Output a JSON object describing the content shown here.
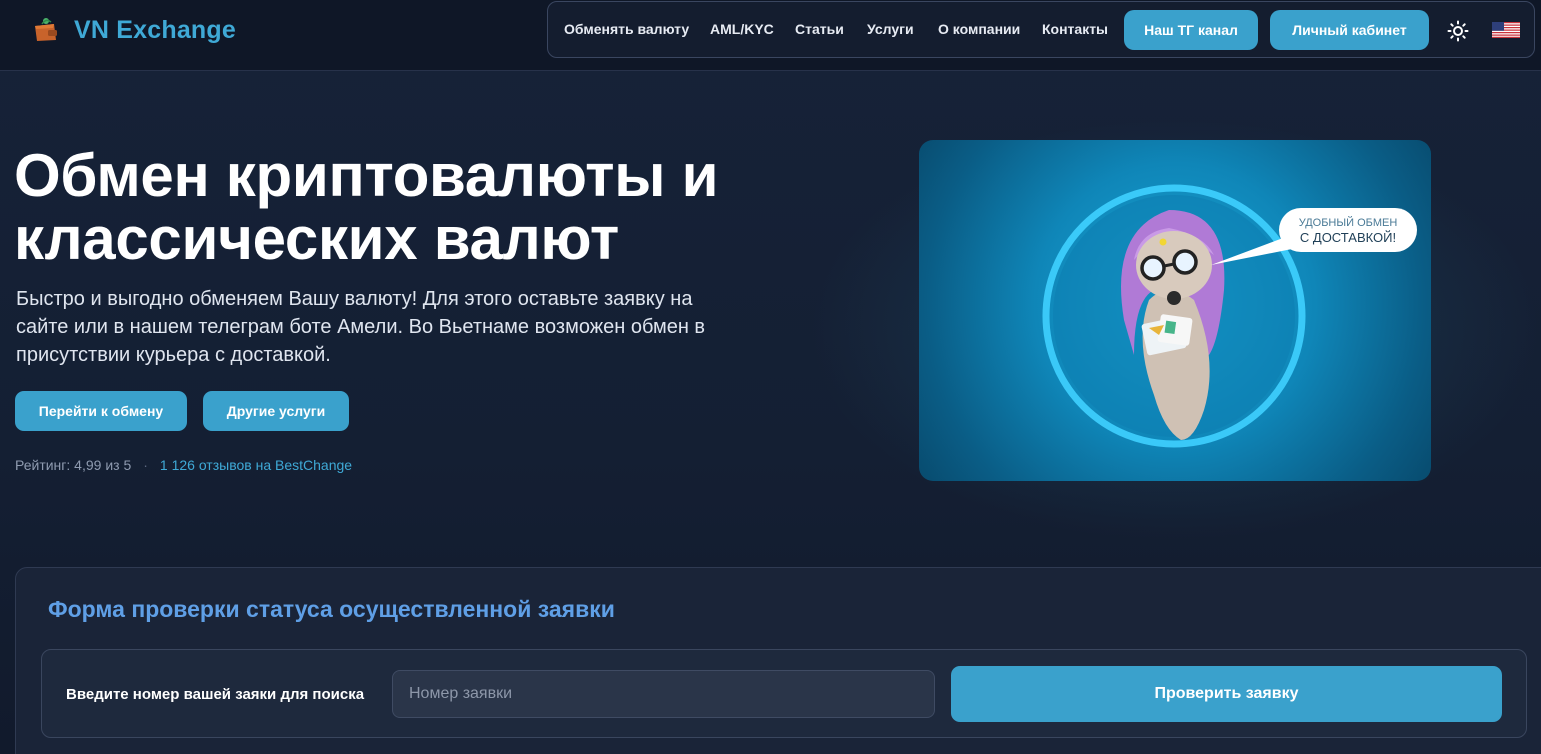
{
  "header": {
    "brand": "VN Exchange",
    "nav": [
      {
        "label": "Обменять валюту"
      },
      {
        "label": "AML/KYC"
      },
      {
        "label": "Статьи"
      },
      {
        "label": "Услуги"
      },
      {
        "label": "О компании"
      },
      {
        "label": "Контакты"
      }
    ],
    "tg_button": "Наш ТГ канал",
    "cabinet_button": "Личный кабинет",
    "theme_icon": "sun-icon",
    "language_icon": "us-flag-icon"
  },
  "hero": {
    "title": "Обмен криптовалюты и классических валют",
    "subtitle": "Быстро и выгодно обменяем Вашу валюту! Для этого оставьте заявку на сайте или в нашем телеграм боте Амели. Во Вьетнаме возможен обмен в присутствии курьера с доставкой.",
    "primary_button": "Перейти к обмену",
    "secondary_button": "Другие услуги",
    "rating": "Рейтинг: 4,99 из 5",
    "separator": "·",
    "reviews": "1 126 отзывов на BestChange",
    "bubble_line1": "УДОБНЫЙ ОБМЕН",
    "bubble_line2": "С ДОСТАВКОЙ!"
  },
  "status_form": {
    "title": "Форма проверки статуса осуществленной заявки",
    "label": "Введите номер вашей заяки для поиска",
    "input_placeholder": "Номер заявки",
    "input_value": "",
    "submit_button": "Проверить заявку"
  },
  "colors": {
    "accent": "#3aa1cc",
    "brand": "#3fa9d6",
    "form_title": "#5f9fe6",
    "background": "#141f33"
  }
}
